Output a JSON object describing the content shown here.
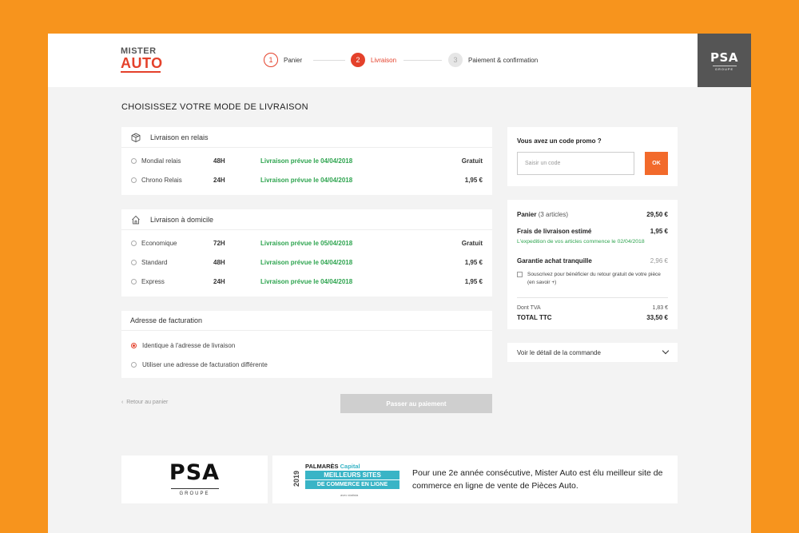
{
  "header": {
    "logo_top": "MISTER",
    "logo_bottom": "AUTO",
    "steps": [
      {
        "num": "1",
        "label": "Panier"
      },
      {
        "num": "2",
        "label": "Livraison"
      },
      {
        "num": "3",
        "label": "Paiement & confirmation"
      }
    ],
    "partner_logo": "PSA",
    "partner_sub": "GROUPE"
  },
  "page_title": "CHOISISSEZ VOTRE MODE DE LIVRAISON",
  "relay": {
    "title": "Livraison en relais",
    "icon": "package-icon",
    "options": [
      {
        "name": "Mondial relais",
        "duration": "48H",
        "date": "Livraison prévue le 04/04/2018",
        "price": "Gratuit"
      },
      {
        "name": "Chrono Relais",
        "duration": "24H",
        "date": "Livraison prévue le 04/04/2018",
        "price": "1,95 €"
      }
    ]
  },
  "home": {
    "title": "Livraison à domicile",
    "icon": "home-icon",
    "options": [
      {
        "name": "Economique",
        "duration": "72H",
        "date": "Livraison prévue le 05/04/2018",
        "price": "Gratuit"
      },
      {
        "name": "Standard",
        "duration": "48H",
        "date": "Livraison prévue le 04/04/2018",
        "price": "1,95 €"
      },
      {
        "name": "Express",
        "duration": "24H",
        "date": "Livraison prévue le 04/04/2018",
        "price": "1,95 €"
      }
    ]
  },
  "billing": {
    "title": "Adresse de facturation",
    "option_same": "Identique à l'adresse de livraison",
    "option_other": "Utiliser une adresse de facturation différente"
  },
  "back_link": "Retour au panier",
  "pay_button": "Passer au paiement",
  "promo": {
    "title": "Vous avez un code promo ?",
    "placeholder": "Saisir un code",
    "ok": "OK"
  },
  "summary": {
    "cart_label": "Panier",
    "cart_count": "(3 articles)",
    "cart_value": "29,50 €",
    "shipping_label": "Frais de livraison estimé",
    "shipping_value": "1,95 €",
    "shipping_note": "L'expedition de vos articles commence le 02/04/2018",
    "warranty_label": "Garantie achat tranquille",
    "warranty_value": "2,96 €",
    "warranty_text": "Souscrivez pour bénéficier du retour gratuit de votre pièce (en savoir +)",
    "tva_label": "Dont TVA",
    "tva_value": "1,83 €",
    "total_label": "TOTAL TTC",
    "total_value": "33,50 €"
  },
  "order_detail": "Voir le détail de la commande",
  "footer": {
    "psa_logo": "PSA",
    "psa_sub": "GROUPE",
    "badge_year": "2019",
    "badge_line1": "PALMARÈS",
    "badge_line1_accent": "Capital",
    "badge_line2": "MEILLEURS SITES",
    "badge_line3": "DE COMMERCE EN LIGNE",
    "badge_line4": "avec statista",
    "text": "Pour une 2e année consécutive, Mister Auto est élu meilleur site de commerce en ligne de vente de Pièces Auto."
  },
  "colors": {
    "background": "#f7941d",
    "accent": "#e4412b",
    "green": "#2ea44f",
    "ok_button": "#f26a2b"
  }
}
